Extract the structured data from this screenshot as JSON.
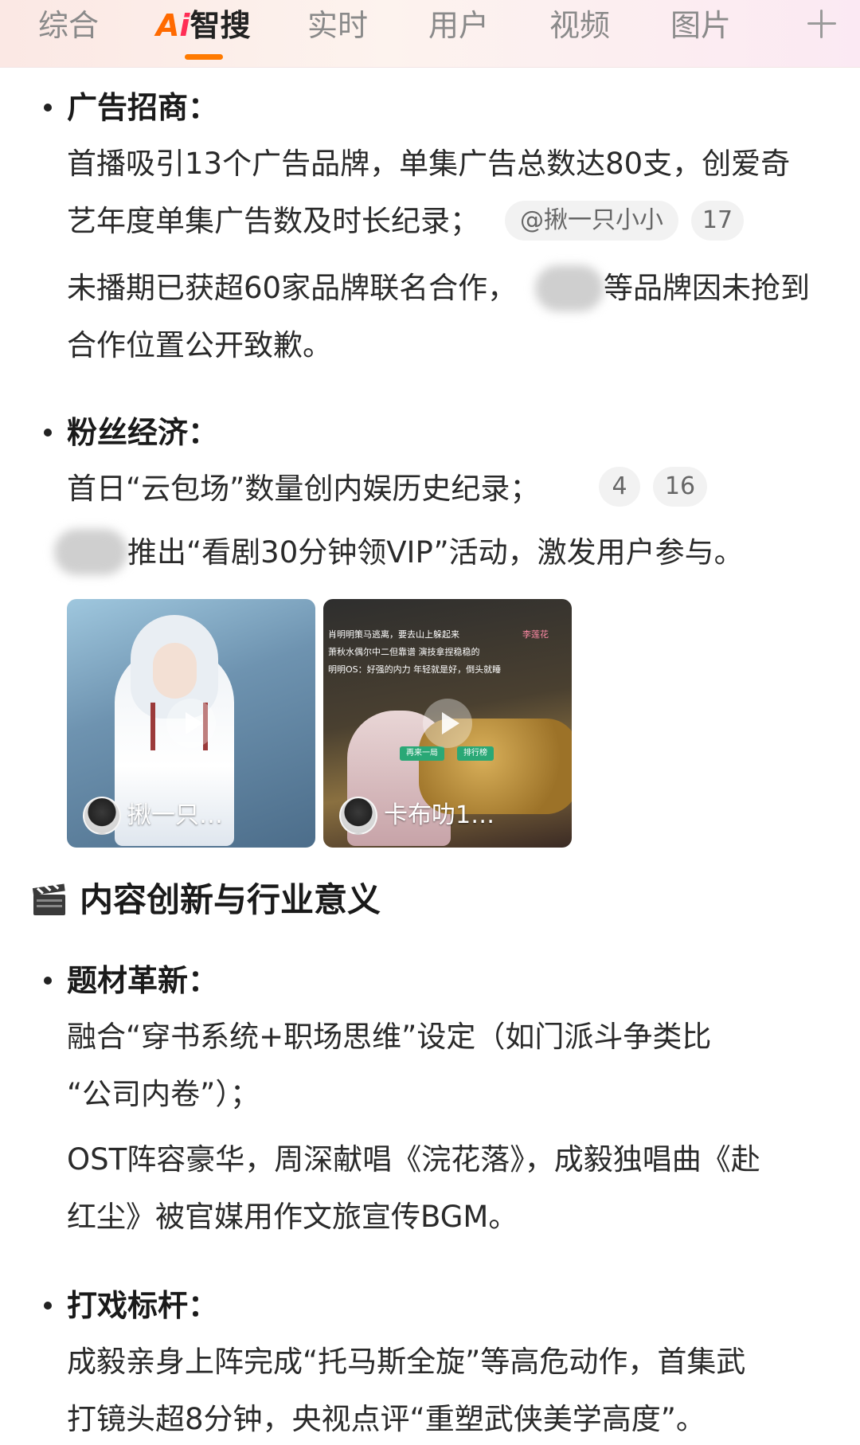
{
  "tabs": [
    {
      "label": "综合",
      "active": false
    },
    {
      "label": "Ai智搜",
      "active": true
    },
    {
      "label": "实时",
      "active": false
    },
    {
      "label": "用户",
      "active": false
    },
    {
      "label": "视频",
      "active": false
    },
    {
      "label": "图片",
      "active": false
    }
  ],
  "ai_tab": {
    "a": "A",
    "i": "i",
    "rest": "智搜"
  },
  "colors": {
    "accent": "#ff7a00",
    "brand_a": "#ff6a00",
    "brand_i": "#ff2d55"
  },
  "icons": {
    "add": "plus-icon",
    "section": "clapper-icon",
    "video": "play-icon"
  },
  "sections": {
    "ads": {
      "heading": "广告招商：",
      "line1": "首播吸引13个广告品牌，单集广告总数达80支，创爱奇",
      "line2": "艺年度单集广告数及时长纪录；",
      "chip_author": "@揪一只小小",
      "chip_count": "17",
      "line3_after_blur": "等品牌因未抢到",
      "line3_before_blur": "未播期已获超60家品牌联名合作，",
      "line4": "合作位置公开致歉。"
    },
    "fans": {
      "heading": "粉丝经济：",
      "line1": "首日“云包场”数量创内娱历史纪录；",
      "chip1": "4",
      "chip2": "16",
      "line2": "推出“看剧30分钟领VIP”活动，激发用户参与。"
    },
    "videos": [
      {
        "author": "揪一只…"
      },
      {
        "author": "卡布叻1…",
        "overlay_lines": [
          "肖明明策马逃离，要去山上躲起来",
          "萧秋水偶尔中二但靠谱   演技拿捏稳稳的",
          "明明OS：好强的内力   年轻就是好，倒头就睡"
        ],
        "overlay_buttons": [
          "再来一局",
          "排行榜"
        ],
        "overlay_tag": "李莲花"
      }
    ],
    "innovation": {
      "title": "内容创新与行业意义",
      "topic": {
        "heading": "题材革新：",
        "line1": "融合“穿书系统+职场思维”设定（如门派斗争类比",
        "line2": "“公司内卷”）；",
        "line3": "OST阵容豪华，周深献唱《浣花落》，成毅独唱曲《赴",
        "line4": "红尘》被官媒用作文旅宣传BGM。"
      },
      "action": {
        "heading": "打戏标杆：",
        "line1": "成毅亲身上阵完成“托马斯全旋”等高危动作，首集武",
        "line2": "打镜头超8分钟，央视点评“重塑武侠美学高度”。"
      }
    }
  }
}
